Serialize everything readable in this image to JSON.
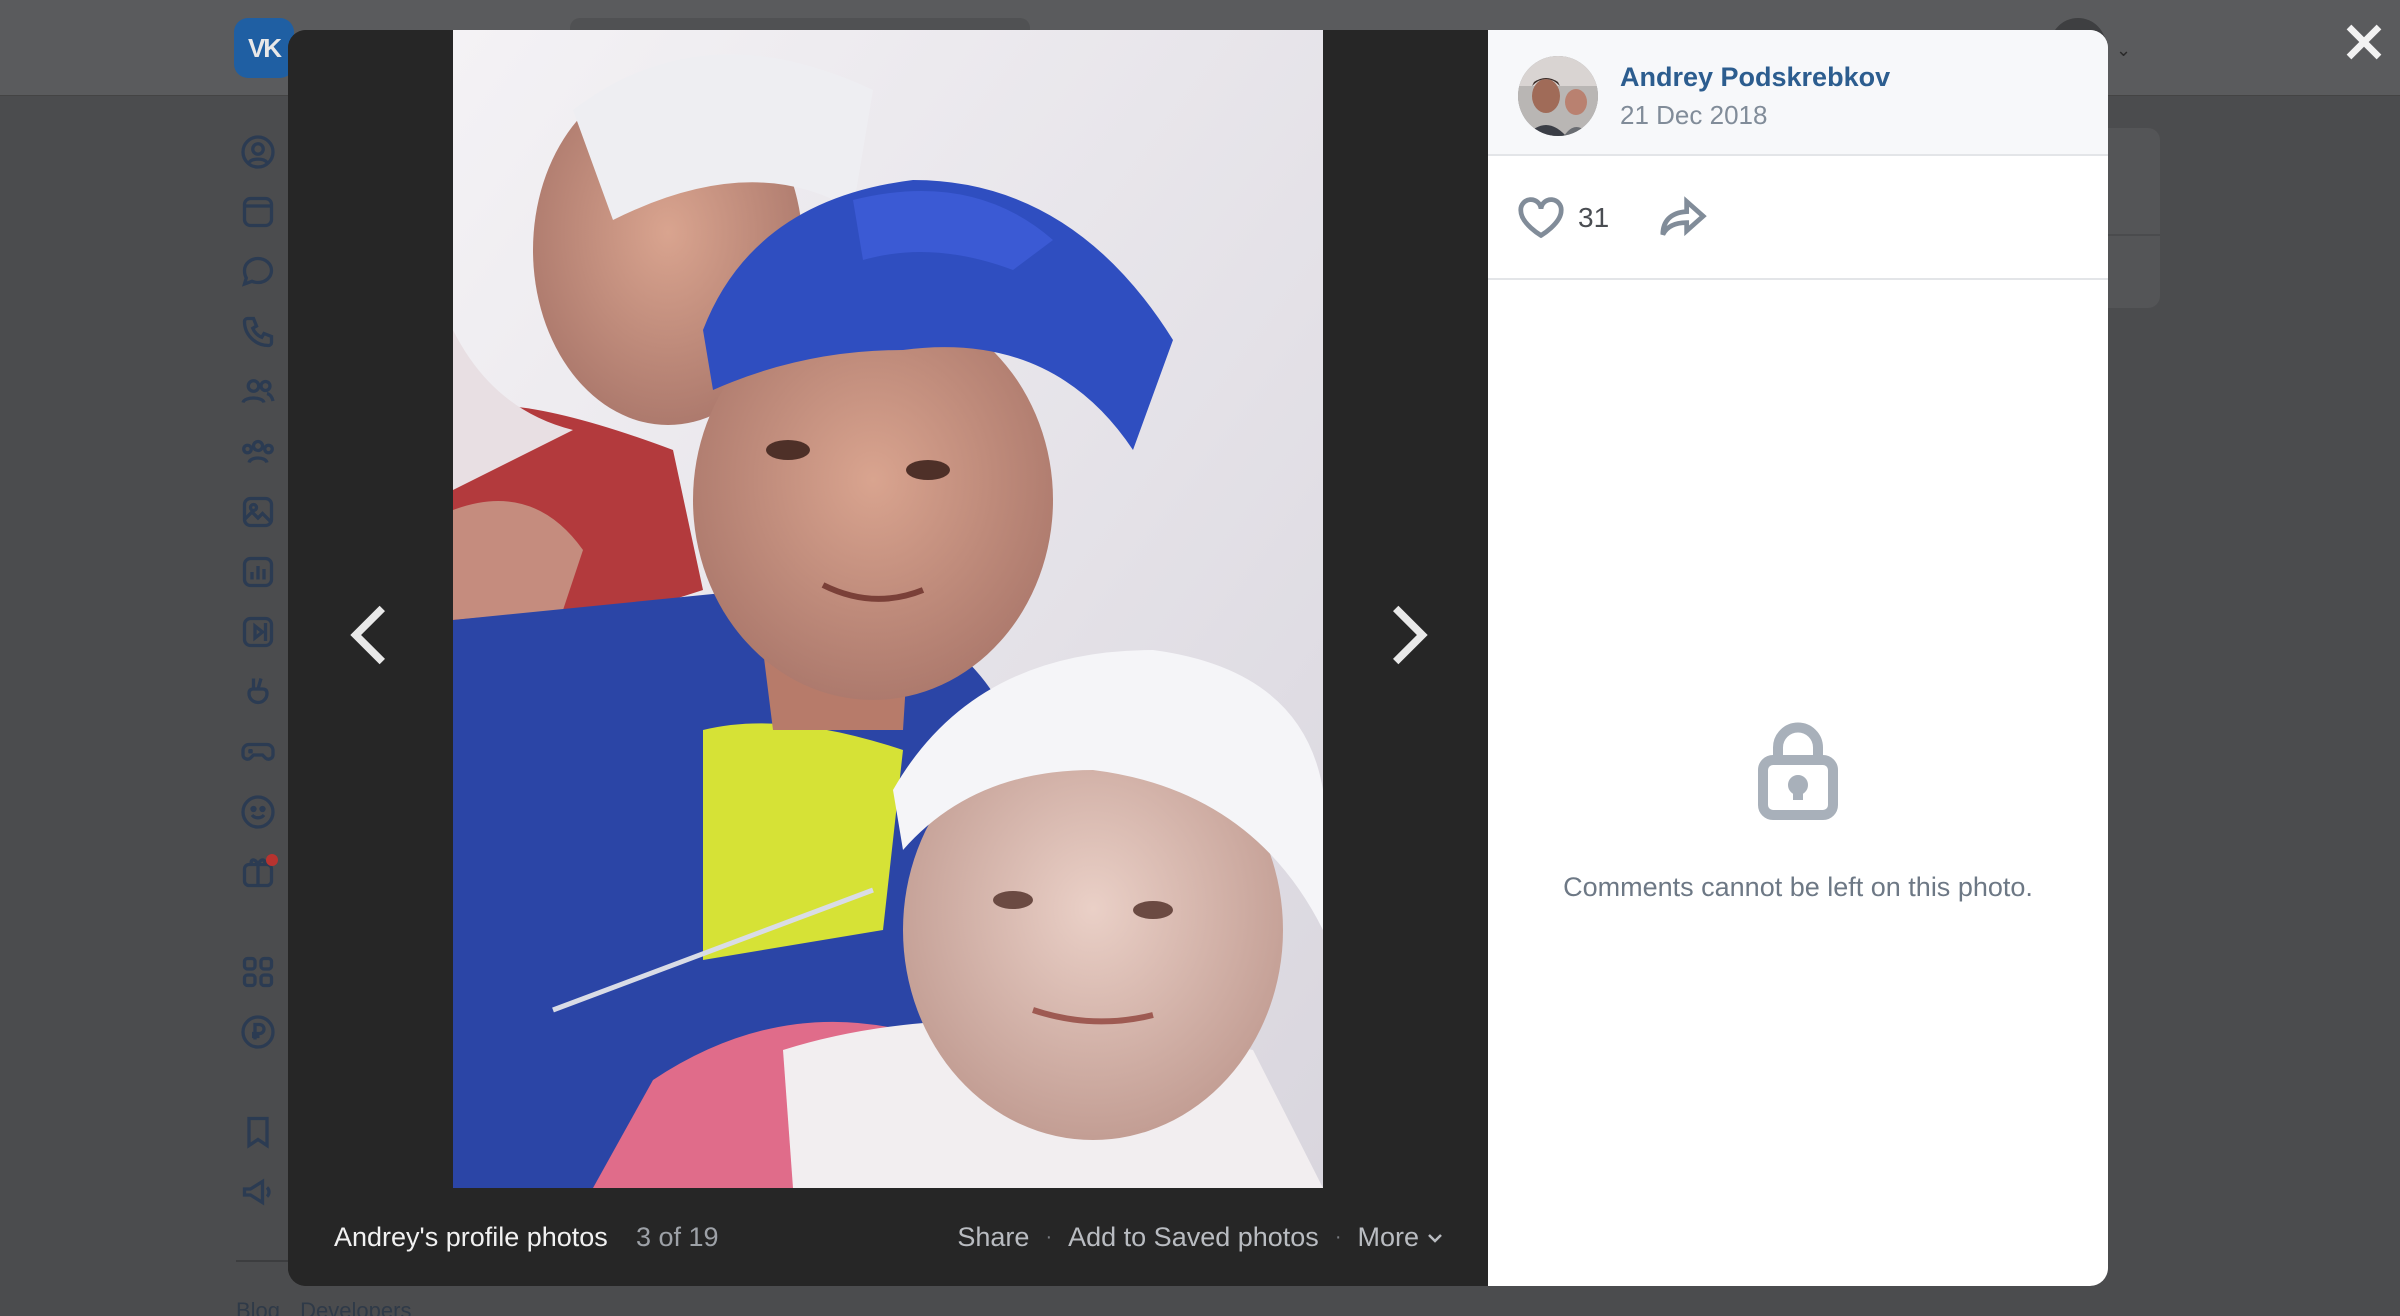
{
  "background": {
    "logo_text": "VK",
    "footer_links": [
      "Blog",
      "Developers"
    ]
  },
  "viewer": {
    "album_title": "Andrey's profile photos",
    "counter": "3 of 19",
    "actions": {
      "share": "Share",
      "add_saved": "Add to Saved photos",
      "more": "More",
      "separator": "·"
    }
  },
  "post": {
    "author_name": "Andrey Podskrebkov",
    "date": "21 Dec 2018",
    "likes": "31"
  },
  "comments": {
    "disabled_message": "Comments cannot be left on this photo."
  },
  "icons": {
    "close": "close-icon",
    "prev": "chevron-left-icon",
    "next": "chevron-right-icon",
    "like": "heart-icon",
    "share": "share-arrow-icon",
    "lock": "lock-icon",
    "more": "chevron-down-icon"
  },
  "colors": {
    "author_link": "#2c5d8f",
    "secondary_text": "#818c99",
    "viewer_bg": "#262626",
    "overlay_bg": "#4b4c4e"
  }
}
